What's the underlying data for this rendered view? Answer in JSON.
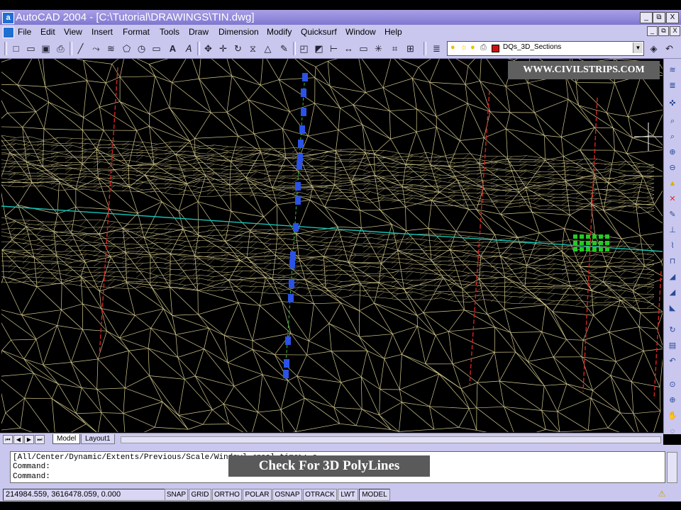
{
  "title_bar": {
    "app_icon_letter": "a",
    "title": "AutoCAD 2004 - [C:\\Tutorial\\DRAWINGS\\TIN.dwg]",
    "min": "_",
    "restore": "⧉",
    "close": "X"
  },
  "menu_bar": {
    "items": [
      "File",
      "Edit",
      "View",
      "Insert",
      "Format",
      "Tools",
      "Draw",
      "Dimension",
      "Modify",
      "Quicksurf",
      "Window",
      "Help"
    ]
  },
  "toolbar": {
    "text_tool": "A",
    "layer_name": "DQs_3D_Sections"
  },
  "watermark": "WWW.CIVILSTRIPS.COM",
  "tabs": {
    "model": "Model",
    "layout1": "Layout1"
  },
  "command": {
    "history_line": "[All/Center/Dynamic/Extents/Previous/Scale/Window] <real time>: e",
    "line2": "Command:",
    "prompt": "Command:",
    "caption": "Check For 3D PolyLines"
  },
  "status_bar": {
    "coordinates": "214984.559, 3616478.059, 0.000",
    "buttons": [
      "SNAP",
      "GRID",
      "ORTHO",
      "POLAR",
      "OSNAP",
      "OTRACK",
      "LWT",
      "MODEL"
    ]
  },
  "colors": {
    "mesh": "#d2c88c",
    "alignment": "#19c3b4",
    "polyline": "#2a52e6",
    "section_line": "#cc2222",
    "marker": "#22cc22"
  }
}
